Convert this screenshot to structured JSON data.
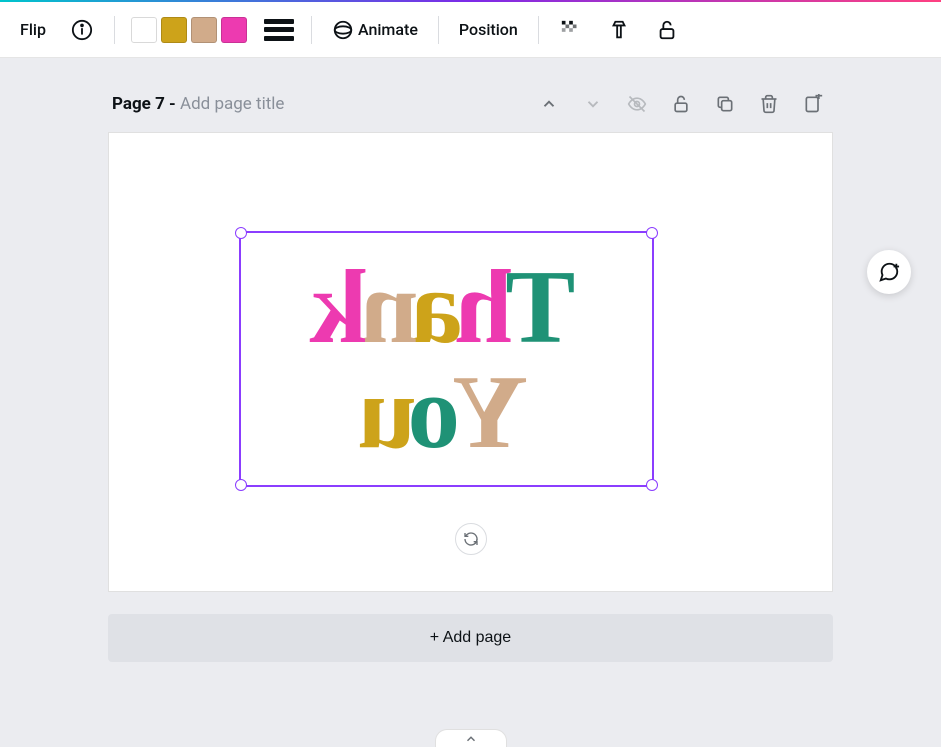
{
  "toolbar": {
    "flip_label": "Flip",
    "animate_label": "Animate",
    "position_label": "Position",
    "colors": {
      "teal": "#1f9276",
      "mustard": "#cda31a",
      "tan": "#d1ab8a",
      "pink": "#ed3ab0"
    }
  },
  "page": {
    "label": "Page 7 - ",
    "placeholder": "Add page title"
  },
  "canvas": {
    "text": {
      "line1": [
        {
          "char": "T",
          "color": "#1f9276"
        },
        {
          "char": "h",
          "color": "#ed3ab0"
        },
        {
          "char": "a",
          "color": "#cda31a"
        },
        {
          "char": "n",
          "color": "#d1ab8a"
        },
        {
          "char": "k",
          "color": "#ed3ab0"
        }
      ],
      "line2": [
        {
          "char": "Y",
          "color": "#d1ab8a"
        },
        {
          "char": "o",
          "color": "#1f9276"
        },
        {
          "char": "u",
          "color": "#cda31a"
        }
      ]
    },
    "transform": "flipped-horizontal"
  },
  "actions": {
    "add_page": "+ Add page"
  }
}
